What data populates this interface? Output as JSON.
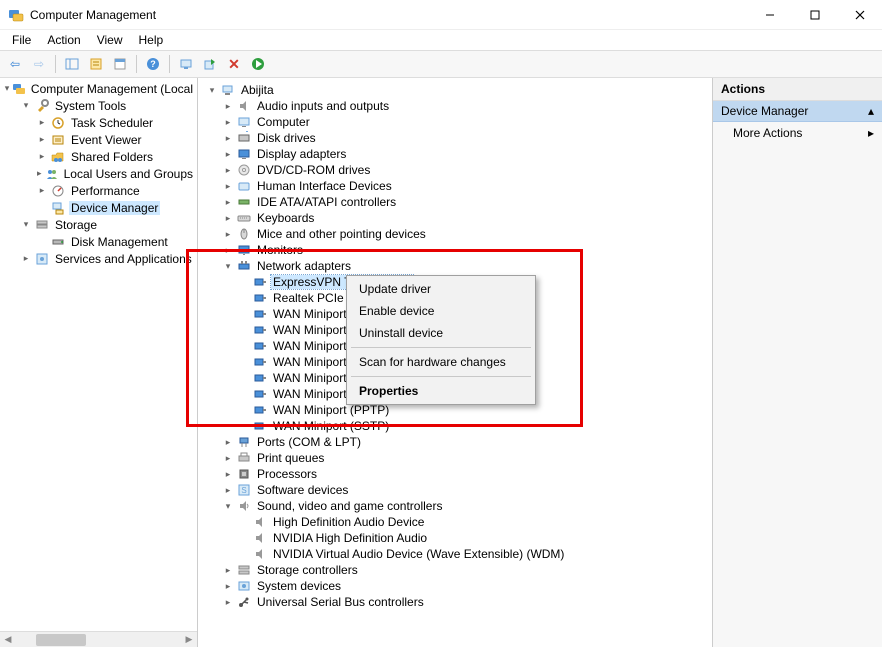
{
  "window": {
    "title": "Computer Management"
  },
  "menu": {
    "file": "File",
    "action": "Action",
    "view": "View",
    "help": "Help"
  },
  "left_tree": {
    "root": "Computer Management (Local",
    "system_tools": "System Tools",
    "task_scheduler": "Task Scheduler",
    "event_viewer": "Event Viewer",
    "shared_folders": "Shared Folders",
    "local_users": "Local Users and Groups",
    "performance": "Performance",
    "device_manager": "Device Manager",
    "storage": "Storage",
    "disk_management": "Disk Management",
    "services_apps": "Services and Applications"
  },
  "device_tree": {
    "root": "Abijita",
    "audio_io": "Audio inputs and outputs",
    "computer": "Computer",
    "disk_drives": "Disk drives",
    "display_adapters": "Display adapters",
    "dvd": "DVD/CD-ROM drives",
    "hid": "Human Interface Devices",
    "ide": "IDE ATA/ATAPI controllers",
    "keyboards": "Keyboards",
    "mice": "Mice and other pointing devices",
    "monitors": "Monitors",
    "network_adapters": "Network adapters",
    "net_items": [
      "ExpressVPN TAP Adapter",
      "Realtek PCIe GbE",
      "WAN Miniport (I",
      "WAN Miniport (I",
      "WAN Miniport (I",
      "WAN Miniport (I",
      "WAN Miniport (I",
      "WAN Miniport (I",
      "WAN Miniport (PPTP)",
      "WAN Miniport (SSTP)"
    ],
    "ports": "Ports (COM & LPT)",
    "print_queues": "Print queues",
    "processors": "Processors",
    "software_devices": "Software devices",
    "sound": "Sound, video and game controllers",
    "sound_items": [
      "High Definition Audio Device",
      "NVIDIA High Definition Audio",
      "NVIDIA Virtual Audio Device (Wave Extensible) (WDM)"
    ],
    "storage_controllers": "Storage controllers",
    "system_devices": "System devices",
    "usb": "Universal Serial Bus controllers"
  },
  "context_menu": {
    "update": "Update driver",
    "enable": "Enable device",
    "uninstall": "Uninstall device",
    "scan": "Scan for hardware changes",
    "properties": "Properties"
  },
  "actions": {
    "header": "Actions",
    "section": "Device Manager",
    "more": "More Actions"
  }
}
